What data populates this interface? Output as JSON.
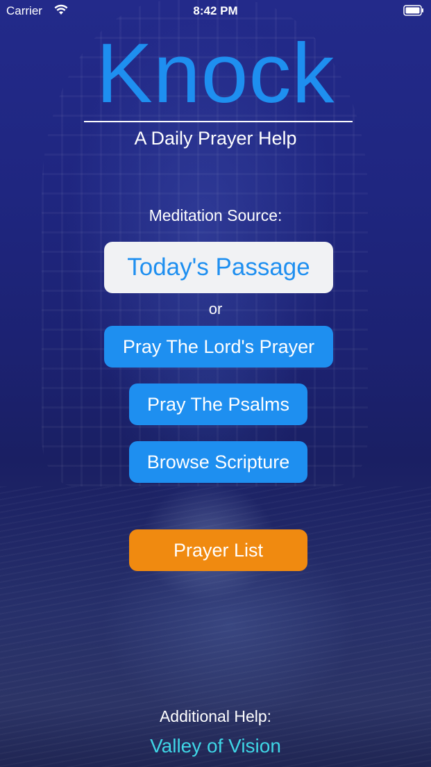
{
  "status_bar": {
    "carrier": "Carrier",
    "time": "8:42 PM",
    "wifi_icon": "wifi-icon",
    "battery_icon": "battery-icon"
  },
  "header": {
    "title": "Knock",
    "subtitle": "A Daily Prayer Help"
  },
  "meditation": {
    "label": "Meditation Source:",
    "todays_passage": "Today's Passage",
    "or": "or",
    "lords_prayer": "Pray The Lord's Prayer",
    "psalms": "Pray The Psalms",
    "browse": "Browse Scripture"
  },
  "prayer_list": {
    "label": "Prayer List"
  },
  "footer": {
    "help_label": "Additional Help:",
    "link": "Valley of Vision"
  },
  "colors": {
    "accent_blue": "#1e8ff0",
    "accent_orange": "#f08a10",
    "link_cyan": "#3fd6e6",
    "passage_bg": "#f1f2f4"
  }
}
